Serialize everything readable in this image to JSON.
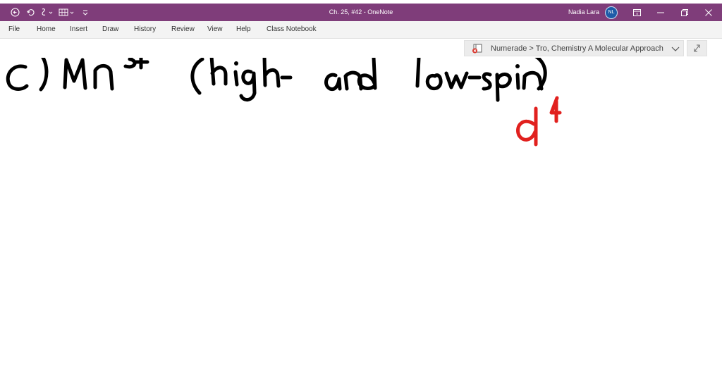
{
  "window": {
    "title": "Ch. 25, #42  -  OneNote",
    "user_name": "Nadia Lara",
    "user_initials": "NL"
  },
  "quick_access": {
    "icons": [
      "back-icon",
      "undo-icon",
      "touch-mode-icon",
      "table-icon",
      "customize-icon"
    ]
  },
  "menu": {
    "items": [
      "File",
      "Home",
      "Insert",
      "Draw",
      "History",
      "Review",
      "View",
      "Help",
      "Class Notebook"
    ]
  },
  "notebook_bar": {
    "breadcrumb": "Numerade > Tro, Chemistry A Molecular Approach"
  },
  "ink": {
    "line1": "c) Mn3+ (high- and low-spin)",
    "annotation": "d4"
  },
  "colors": {
    "title_bar": "#7f3d7a",
    "ink_black": "#000000",
    "ink_red": "#e1201e"
  }
}
